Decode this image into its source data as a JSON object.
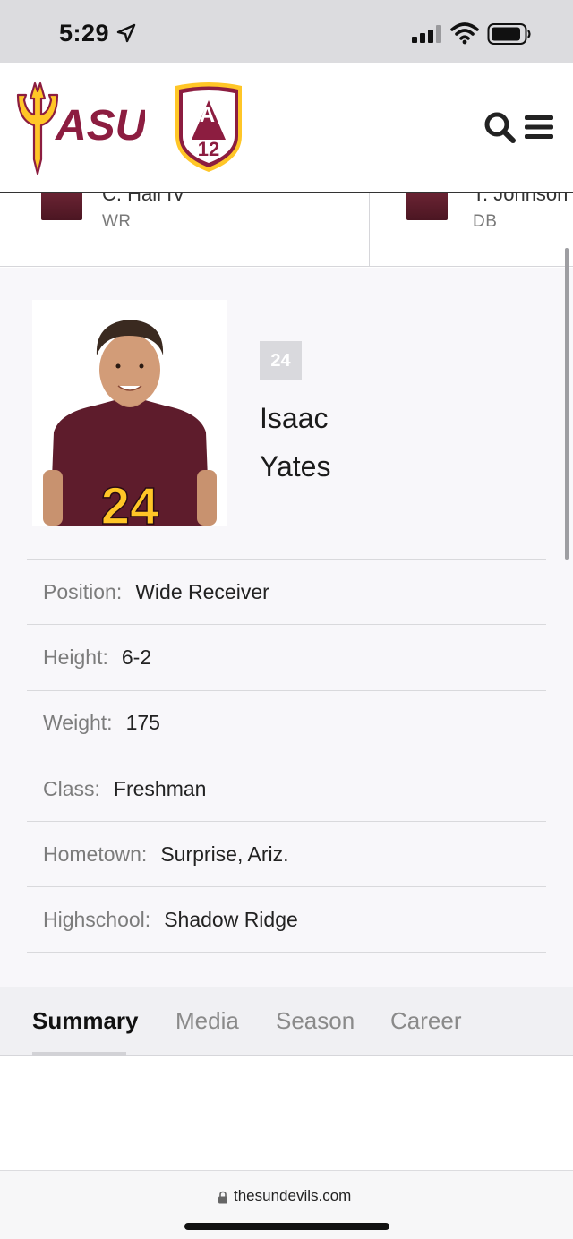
{
  "status_bar": {
    "time": "5:29"
  },
  "header": {
    "asu_logo_text": "ASU",
    "pac_logo_text": "PAC",
    "pac_logo_number": "12"
  },
  "roster_strip": {
    "cards": [
      {
        "name": "C. Hall IV",
        "position": "WR"
      },
      {
        "name": "T. Johnson",
        "position": "DB"
      }
    ]
  },
  "player": {
    "number": "24",
    "first_name": "Isaac",
    "last_name": "Yates",
    "jersey_photo_number": "24"
  },
  "info": [
    {
      "label": "Position:",
      "value": "Wide Receiver"
    },
    {
      "label": "Height:",
      "value": "6-2"
    },
    {
      "label": "Weight:",
      "value": "175"
    },
    {
      "label": "Class:",
      "value": "Freshman"
    },
    {
      "label": "Hometown:",
      "value": "Surprise, Ariz."
    },
    {
      "label": "Highschool:",
      "value": "Shadow Ridge"
    }
  ],
  "tabs": [
    {
      "label": "Summary",
      "active": true
    },
    {
      "label": "Media",
      "active": false
    },
    {
      "label": "Season",
      "active": false
    },
    {
      "label": "Career",
      "active": false
    }
  ],
  "url_bar": {
    "domain": "thesundevils.com"
  },
  "colors": {
    "maroon": "#8c1d40",
    "gold": "#ffc627"
  }
}
